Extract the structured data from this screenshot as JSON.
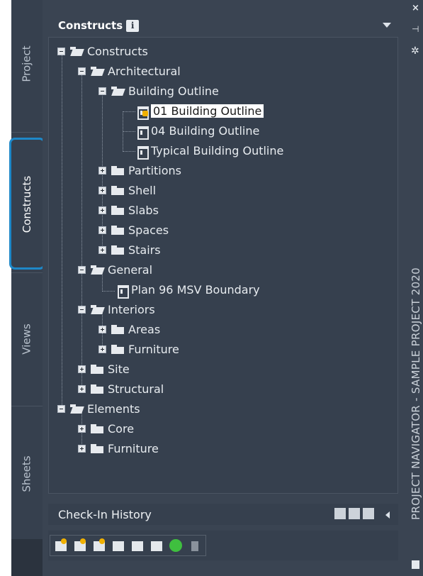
{
  "side_tabs": [
    "Project",
    "Constructs",
    "Views",
    "Sheets"
  ],
  "palette": {
    "title": "Constructs",
    "info_icon": "i"
  },
  "tree": [
    {
      "label": "Constructs"
    },
    {
      "label": "Architectural"
    },
    {
      "label": "Building Outline"
    },
    {
      "label": "01 Building Outline"
    },
    {
      "label": "04 Building Outline"
    },
    {
      "label": "Typical Building Outline"
    },
    {
      "label": "Partitions"
    },
    {
      "label": "Shell"
    },
    {
      "label": "Slabs"
    },
    {
      "label": "Spaces"
    },
    {
      "label": "Stairs"
    },
    {
      "label": "General"
    },
    {
      "label": "Plan 96 MSV Boundary"
    },
    {
      "label": "Interiors"
    },
    {
      "label": "Areas"
    },
    {
      "label": "Furniture"
    },
    {
      "label": "Site"
    },
    {
      "label": "Structural"
    },
    {
      "label": "Elements"
    },
    {
      "label": "Core"
    },
    {
      "label": "Furniture"
    }
  ],
  "checkin": {
    "title": "Check-In History"
  },
  "right_bar": {
    "close": "×",
    "pin": "⊣",
    "gear": "✲",
    "title": "PROJECT NAVIGATOR - SAMPLE PROJECT 2020"
  },
  "icons": {
    "expand_minus": "collapse-icon",
    "expand_plus": "expand-icon",
    "folder": "folder-icon",
    "drawing": "drawing-file-icon"
  },
  "colors": {
    "panel_bg": "#3a4452",
    "tree_bg": "#36404e",
    "highlight": "#1e88c8",
    "selection": "#ffffff"
  }
}
